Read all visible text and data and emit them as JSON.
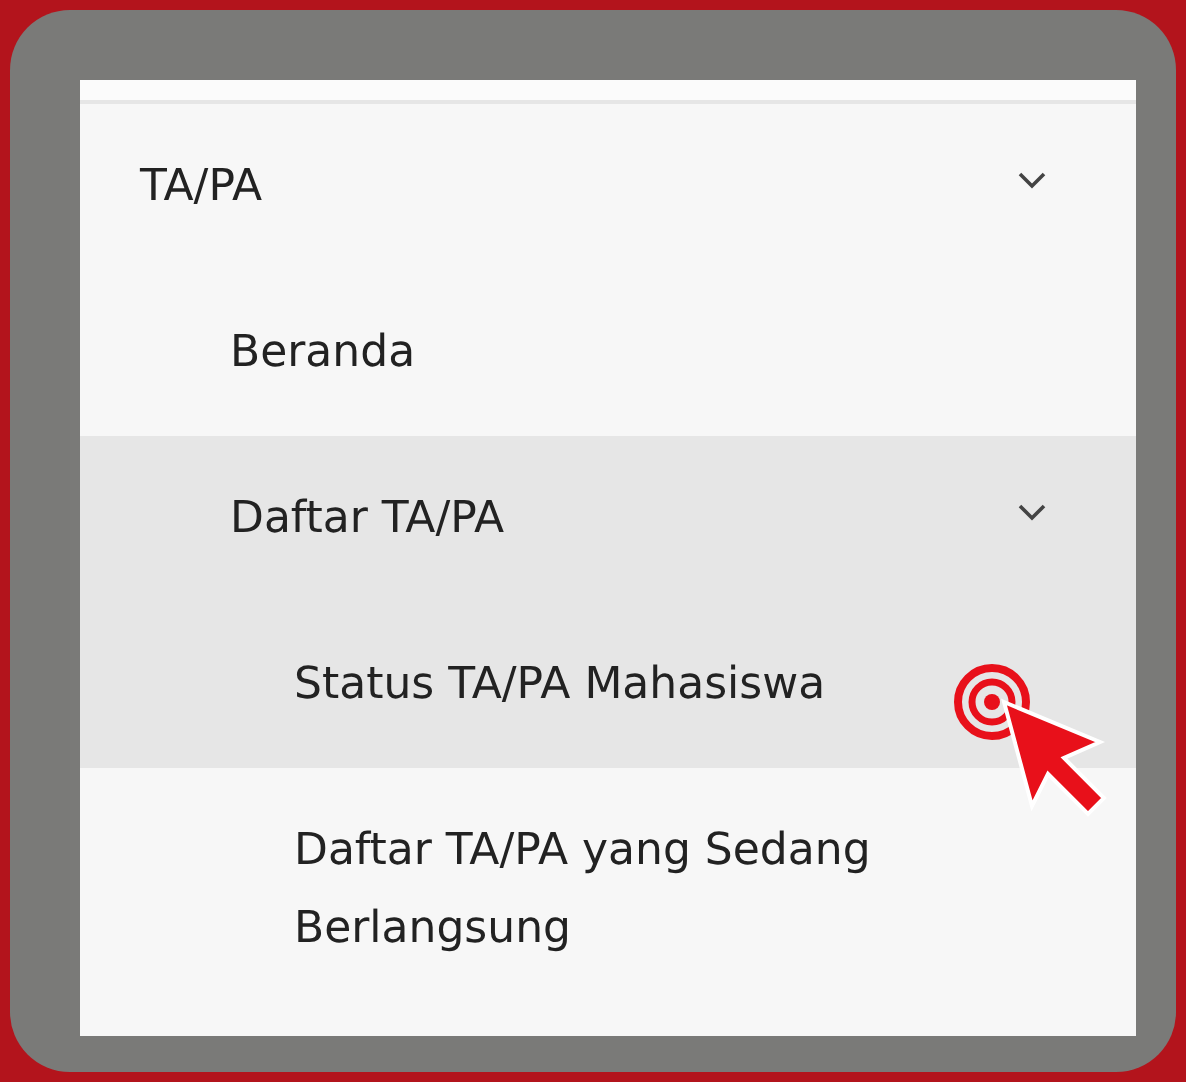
{
  "menu": [
    {
      "label": "TA/PA",
      "expanded": true,
      "selected": false,
      "children": [
        {
          "label": "Beranda",
          "selected": false
        },
        {
          "label": "Daftar TA/PA",
          "expanded": true,
          "selected": true,
          "children": [
            {
              "label": "Status TA/PA Mahasiswa",
              "selected": true
            },
            {
              "label": "Daftar TA/PA yang Sedang Berlangsung",
              "selected": false
            }
          ]
        }
      ]
    }
  ]
}
